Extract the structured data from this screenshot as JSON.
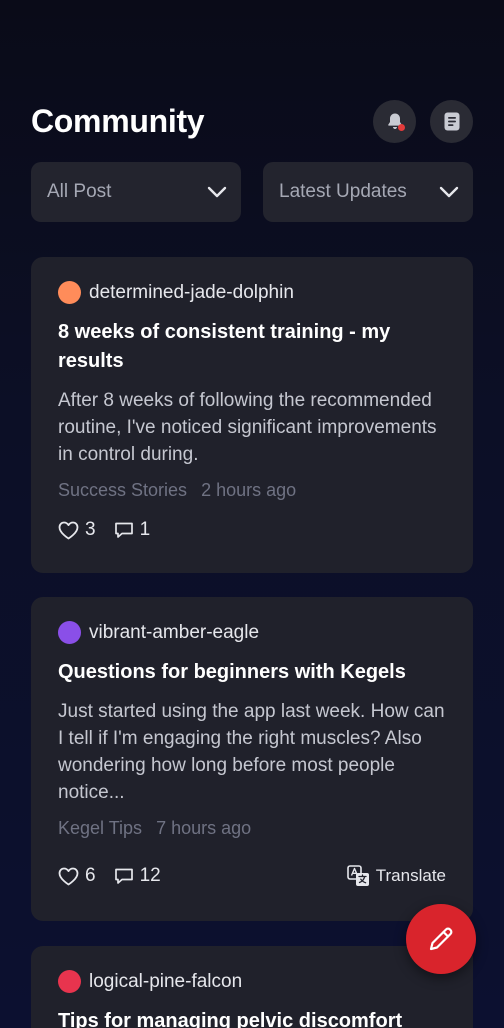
{
  "header": {
    "title": "Community"
  },
  "filters": {
    "category": "All Post",
    "sort": "Latest Updates"
  },
  "posts": [
    {
      "author": "determined-jade-dolphin",
      "avatar_color": "#ff8c5a",
      "title": "8 weeks of consistent training - my results",
      "excerpt": "After 8 weeks of following the recommended routine, I've noticed significant improvements in control during.",
      "category": "Success Stories",
      "time": "2 hours ago",
      "likes": "3",
      "comments": "1"
    },
    {
      "author": "vibrant-amber-eagle",
      "avatar_color": "#8a4fe8",
      "title": "Questions for beginners with Kegels",
      "excerpt": "Just started using the app last week. How can I tell if I'm engaging the right muscles? Also wondering how long before most people notice...",
      "category": "Kegel Tips",
      "time": "7 hours ago",
      "likes": "6",
      "comments": "12",
      "translate_label": "Translate"
    },
    {
      "author": "logical-pine-falcon",
      "avatar_color": "#e8344e",
      "title": "Tips for managing pelvic discomfort"
    }
  ],
  "colors": {
    "accent": "#d9242c",
    "card": "#20212b",
    "notification_dot": "#e23b3b"
  },
  "icons": {
    "notifications": "bell-icon",
    "guidelines": "document-icon",
    "dropdown": "chevron-down-icon",
    "like": "heart-icon",
    "comment": "comment-icon",
    "translate": "translate-icon",
    "compose": "pencil-icon"
  }
}
